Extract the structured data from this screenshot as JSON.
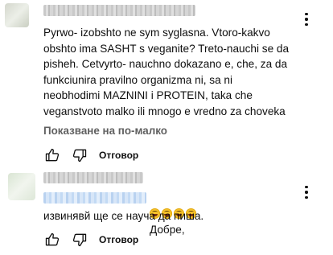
{
  "comments": [
    {
      "text": "Pyrwo- izobshto ne sym syglasna. Vtoro-kakvo\nobshto ima SASHT s veganite? Treto-nauchi se da\npisheh. Cetvyrto- nauchno dokazano e, che, za da\nfunkciunira pravilno organizma ni, sa ni\nneobhodimi MAZNINI i PROTEIN, taka che\nveganstvoto malko ili mnogo e vredno za choveka",
      "show_less": "Показване на по-малко",
      "reply_label": "Отговор"
    },
    {
      "text_line1": "Добре,",
      "text_line2": "извинявй ще се науча да пиша.",
      "reply_label": "Отговор"
    }
  ],
  "icons": {
    "like": "thumb-up-icon",
    "dislike": "thumb-down-icon",
    "menu": "more-vert-icon",
    "emoji": "rolling-laughing-emoji"
  },
  "colors": {
    "text": "#0f0f0f",
    "secondary": "#606060"
  }
}
